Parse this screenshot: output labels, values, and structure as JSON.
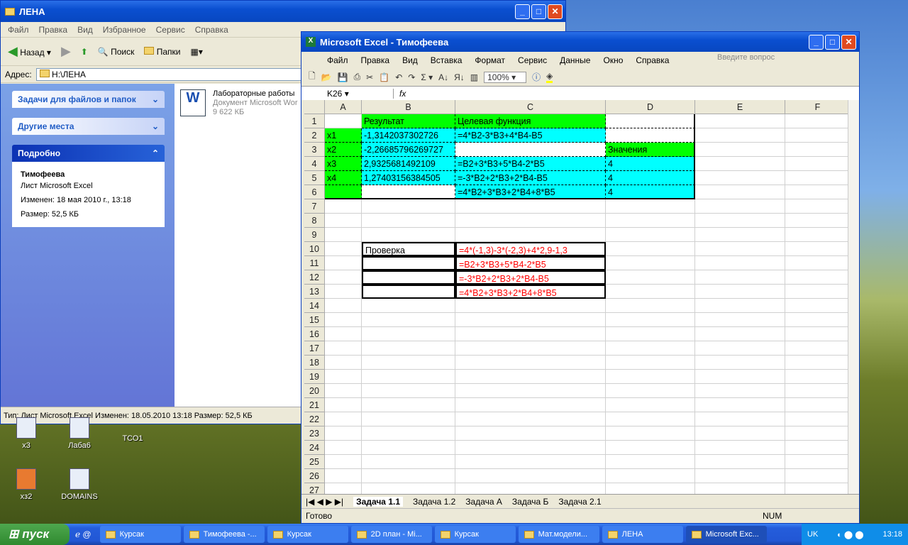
{
  "explorer": {
    "title": "ЛЕНА",
    "menu": [
      "Файл",
      "Правка",
      "Вид",
      "Избранное",
      "Сервис",
      "Справка"
    ],
    "toolbar": {
      "back": "Назад",
      "search": "Поиск",
      "folders": "Папки"
    },
    "address_label": "Адрес:",
    "address": "H:\\ЛЕНА",
    "panels": {
      "tasks": "Задачи для файлов и папок",
      "places": "Другие места",
      "details": "Подробно"
    },
    "details": {
      "name": "Тимофеева",
      "type": "Лист Microsoft Excel",
      "modified": "Изменен: 18 мая 2010 г., 13:18",
      "size": "Размер: 52,5 КБ"
    },
    "file": {
      "name": "Лабораторные работы",
      "type": "Документ Microsoft Wor",
      "size": "9 622 КБ"
    },
    "status": "Тип: Лист Microsoft Excel Изменен: 18.05.2010 13:18 Размер: 52,5 КБ"
  },
  "desktop_icons": [
    "x3",
    "Лаба6",
    "ТСО1",
    "xз2",
    "DOMAINS"
  ],
  "excel": {
    "title": "Microsoft Excel - Тимофеева",
    "menu": [
      "Файл",
      "Правка",
      "Вид",
      "Вставка",
      "Формат",
      "Сервис",
      "Данные",
      "Окно",
      "Справка"
    ],
    "help_placeholder": "Введите вопрос",
    "zoom": "100%",
    "name_box": "K26",
    "fx": "fx",
    "columns": [
      "A",
      "B",
      "C",
      "D",
      "E",
      "F"
    ],
    "cells": {
      "1": [
        "",
        "Результат",
        "Целевая функция",
        "",
        "",
        ""
      ],
      "2": [
        "x1",
        "-1,3142037302726",
        "=4*B2-3*B3+4*B4-B5",
        "",
        "",
        ""
      ],
      "3": [
        "x2",
        "-2,26685796269727",
        "",
        "Значения",
        "",
        ""
      ],
      "4": [
        "x3",
        "2,9325681492109",
        "=B2+3*B3+5*B4-2*B5",
        "4",
        "",
        ""
      ],
      "5": [
        "x4",
        "1,27403156384505",
        "=-3*B2+2*B3+2*B4-B5",
        "4",
        "",
        ""
      ],
      "6": [
        "",
        "",
        "=4*B2+3*B3+2*B4+8*B5",
        "4",
        "",
        ""
      ],
      "10": [
        "",
        "Проверка",
        "=4*(-1,3)-3*(-2,3)+4*2,9-1,3",
        "",
        "",
        ""
      ],
      "11": [
        "",
        "",
        "=B2+3*B3+5*B4-2*B5",
        "",
        "",
        ""
      ],
      "12": [
        "",
        "",
        "=-3*B2+2*B3+2*B4-B5",
        "",
        "",
        ""
      ],
      "13": [
        "",
        "",
        "=4*B2+3*B3+2*B4+8*B5",
        "",
        "",
        ""
      ]
    },
    "row_count": 27,
    "sheets": [
      "Задача 1.1",
      "Задача 1.2",
      "Задача А",
      "Задача Б",
      "Задача 2.1"
    ],
    "status": "Готово",
    "num": "NUM",
    "colors": {
      "green": "#00ff00",
      "cyan": "#00ffff",
      "red": "#ff0000"
    }
  },
  "taskbar": {
    "start": "пуск",
    "tasks": [
      "Курсак",
      "Тимофеева -...",
      "Курсак",
      "2D план - Mi...",
      "Курсак",
      "Мат.модели...",
      "ЛЕНА",
      "Microsoft Exc..."
    ],
    "lang": "UK",
    "clock": "13:18"
  }
}
